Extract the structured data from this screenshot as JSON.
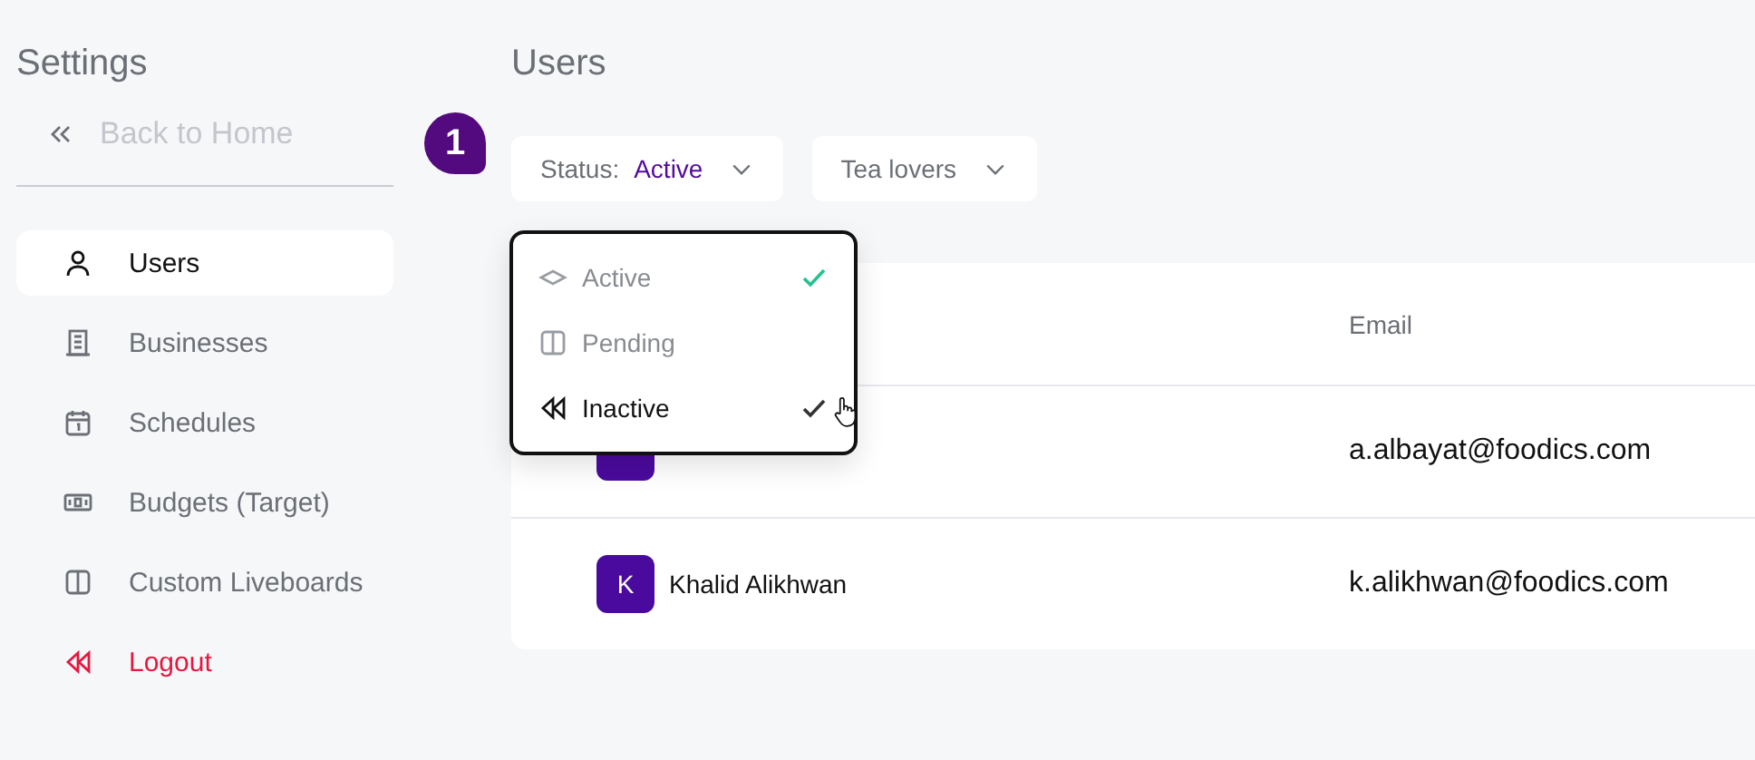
{
  "sidebar": {
    "title": "Settings",
    "back_link": "Back to Home",
    "items": [
      {
        "label": "Users",
        "selected": true,
        "kind": "normal"
      },
      {
        "label": "Businesses",
        "selected": false,
        "kind": "normal"
      },
      {
        "label": "Schedules",
        "selected": false,
        "kind": "normal"
      },
      {
        "label": "Budgets (Target)",
        "selected": false,
        "kind": "normal"
      },
      {
        "label": "Custom Liveboards",
        "selected": false,
        "kind": "normal"
      },
      {
        "label": "Logout",
        "selected": false,
        "kind": "danger"
      }
    ]
  },
  "page": {
    "title": "Users"
  },
  "step_badge": "1",
  "filters": [
    {
      "label": "Status:",
      "value": "Active"
    },
    {
      "label": "Tea lovers"
    }
  ],
  "status_menu": {
    "options": [
      {
        "label": "Active",
        "checked": true,
        "hovered": false
      },
      {
        "label": "Pending",
        "checked": false,
        "hovered": false
      },
      {
        "label": "Inactive",
        "checked": true,
        "hovered": true
      }
    ]
  },
  "table": {
    "columns": [
      "Email"
    ],
    "rows": [
      {
        "email": "a.albayat@foodics.com"
      },
      {
        "avatar": "K",
        "name": "Khalid Alikhwan",
        "email": "k.alikhwan@foodics.com"
      }
    ]
  }
}
